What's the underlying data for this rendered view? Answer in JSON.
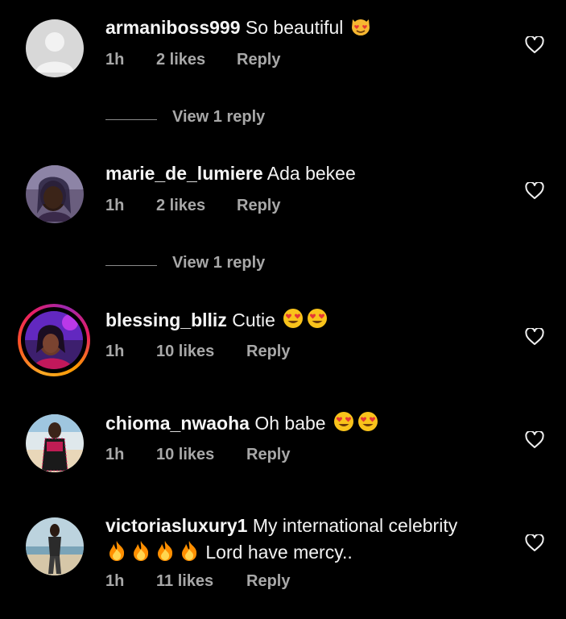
{
  "comments": [
    {
      "username": "armaniboss999",
      "text": "So beautiful",
      "emoji": [
        "heart-eyes-cat"
      ],
      "time": "1h",
      "likes": "2 likes",
      "reply": "Reply",
      "view_replies": "View 1 reply",
      "avatar": "default-avatar"
    },
    {
      "username": "marie_de_lumiere",
      "text": "Ada bekee",
      "emoji": [],
      "time": "1h",
      "likes": "2 likes",
      "reply": "Reply",
      "view_replies": "View 1 reply",
      "avatar": "photo"
    },
    {
      "username": "blessing_blliz",
      "text": "Cutie",
      "emoji": [
        "heart-eyes",
        "heart-eyes"
      ],
      "time": "1h",
      "likes": "10 likes",
      "reply": "Reply",
      "avatar": "photo-with-story-ring"
    },
    {
      "username": "chioma_nwaoha",
      "text": "Oh babe",
      "emoji": [
        "heart-eyes",
        "heart-eyes"
      ],
      "time": "1h",
      "likes": "10 likes",
      "reply": "Reply",
      "avatar": "photo"
    },
    {
      "username": "victoriasluxury1",
      "text": "My international celebrity",
      "text_line2": "Lord have mercy..",
      "emoji": [
        "fire",
        "fire",
        "fire",
        "fire"
      ],
      "time": "1h",
      "likes": "11 likes",
      "reply": "Reply",
      "avatar": "photo"
    }
  ],
  "icons": {
    "like": "heart-outline-icon"
  },
  "colors": {
    "background": "#000000",
    "primary_text": "#f5f5f5",
    "secondary_text": "#a8a8a8",
    "story_ring": [
      "#f9a825",
      "#e91e63",
      "#9c27b0"
    ]
  }
}
